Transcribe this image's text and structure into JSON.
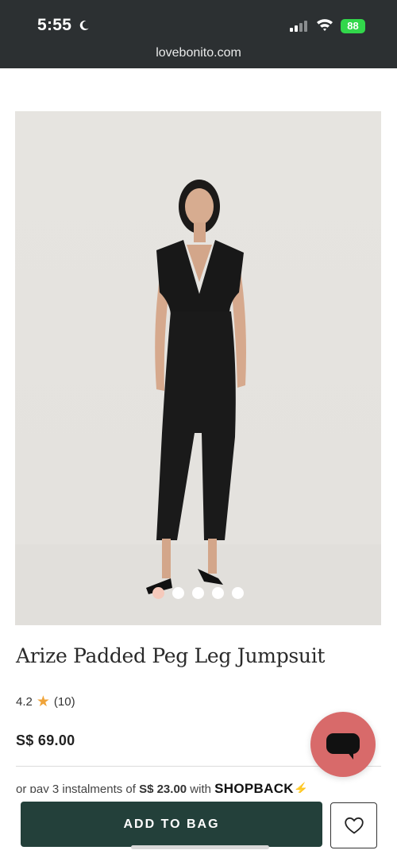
{
  "status_bar": {
    "time": "5:55",
    "battery": "88",
    "moon_icon": "moon-icon",
    "wifi_icon": "wifi-icon",
    "signal_icon": "cellular-signal-icon"
  },
  "browser": {
    "url": "lovebonito.com"
  },
  "gallery": {
    "image_desc_icon": "product-photo",
    "slide_count": 5,
    "active_slide": 1,
    "active_dot_color": "#f5c9bb"
  },
  "product": {
    "title": "Arize Padded Peg Leg Jumpsuit",
    "rating": "4.2",
    "review_count": "(10)",
    "price": "S$ 69.00",
    "installment": {
      "prefix": "or pay 3 instalments of ",
      "amount": "S$ 23.00",
      "middle": " with ",
      "provider": "SHOPBACK",
      "bolt": "⚡"
    }
  },
  "actions": {
    "add_to_bag": "ADD TO BAG",
    "button_color": "#23403a",
    "chat_color": "#d86a6a"
  }
}
